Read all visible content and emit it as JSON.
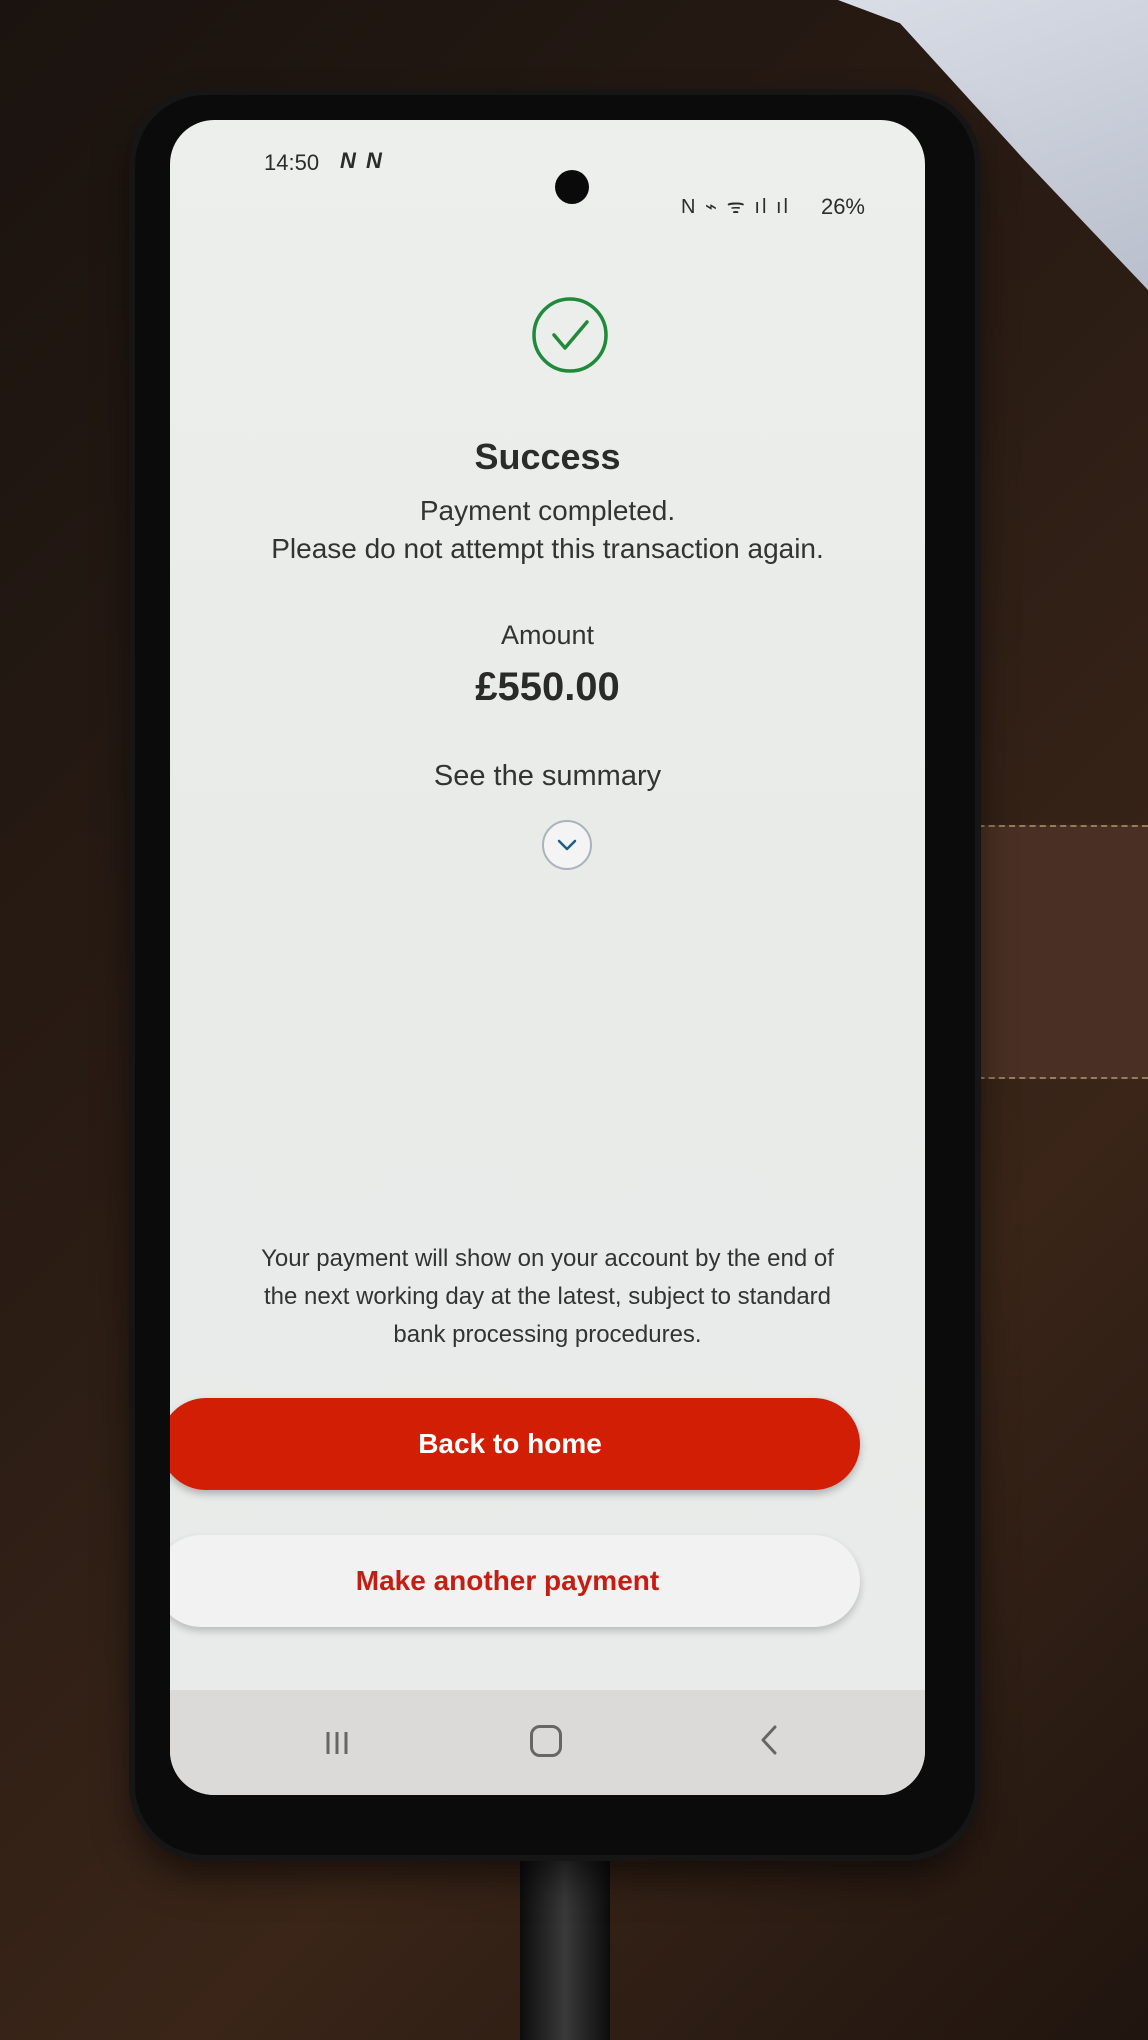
{
  "status_bar": {
    "time": "14:50",
    "left_icons": "N N",
    "right_icons": "N ⌁ ᯤ ıl ıl",
    "battery": "26%"
  },
  "content": {
    "title": "Success",
    "message_line1": "Payment completed.",
    "message_line2": "Please do not attempt this transaction again.",
    "amount_label": "Amount",
    "amount_value": "£550.00",
    "summary_label": "See the summary",
    "footnote_line1": "Your payment will show on your account by the end of",
    "footnote_line2": "the next working day at the latest, subject to standard",
    "footnote_line3": "bank processing procedures."
  },
  "buttons": {
    "back_home": "Back to home",
    "make_another": "Make another payment"
  },
  "colors": {
    "success_green": "#1f8a3a",
    "primary_red": "#d21e05",
    "secondary_text_red": "#c41e14"
  },
  "icons": {
    "success": "check-circle-icon",
    "summary": "chevron-down-icon",
    "nav_recent": "recent-apps-icon",
    "nav_home": "home-icon",
    "nav_back": "back-icon"
  }
}
